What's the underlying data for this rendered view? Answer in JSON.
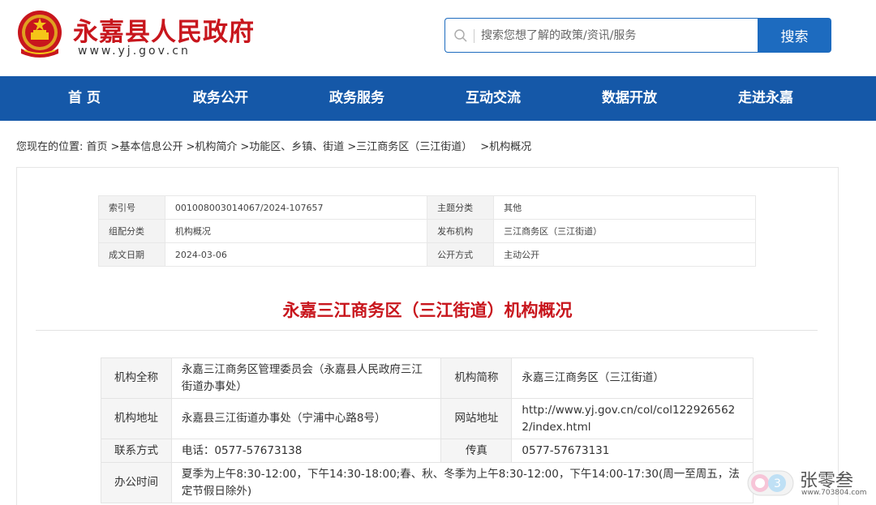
{
  "header": {
    "site_title": "永嘉县人民政府",
    "site_domain": "www.yj.gov.cn",
    "search_placeholder": "搜索您想了解的政策/资讯/服务",
    "search_button": "搜索",
    "brand_red": "#c8161d",
    "brand_blue": "#1558a8"
  },
  "nav": {
    "items": [
      "首 页",
      "政务公开",
      "政务服务",
      "互动交流",
      "数据开放",
      "走进永嘉"
    ]
  },
  "breadcrumb": {
    "prefix": "您现在的位置:",
    "items": [
      "首页",
      "基本信息公开",
      "机构简介",
      "功能区、乡镇、街道",
      "三江商务区（三江街道）",
      "机构概况"
    ],
    "separator": ">"
  },
  "meta": {
    "rows": [
      {
        "k1": "索引号",
        "v1": "001008003014067/2024-107657",
        "k2": "主题分类",
        "v2": "其他"
      },
      {
        "k1": "组配分类",
        "v1": "机构概况",
        "k2": "发布机构",
        "v2": "三江商务区（三江街道）"
      },
      {
        "k1": "成文日期",
        "v1": "2024-03-06",
        "k2": "公开方式",
        "v2": "主动公开"
      }
    ]
  },
  "document": {
    "title": "永嘉三江商务区（三江街道）机构概况"
  },
  "info": {
    "full_name_label": "机构全称",
    "full_name": "永嘉三江商务区管理委员会（永嘉县人民政府三江街道办事处）",
    "short_name_label": "机构简称",
    "short_name": "永嘉三江商务区（三江街道）",
    "address_label": "机构地址",
    "address": "永嘉县三江街道办事处（宁浦中心路8号）",
    "website_label": "网站地址",
    "website": "http://www.yj.gov.cn/col/col1229265622/index.html",
    "contact_label": "联系方式",
    "contact": "电话：0577-57673138",
    "fax_label": "传真",
    "fax": "0577-57673131",
    "hours_label": "办公时间",
    "hours": "夏季为上午8:30-12:00，下午14:30-18:00;春、秋、冬季为上午8:30-12:00，下午14:00-17:30(周一至周五，法定节假日除外)"
  },
  "watermark": {
    "text": "张零叁",
    "url": "www.703804.com"
  }
}
